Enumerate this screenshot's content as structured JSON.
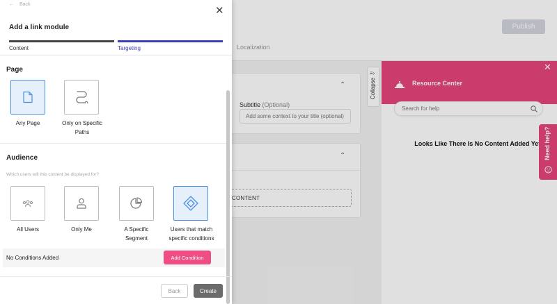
{
  "background": {
    "publish_label": "Publish",
    "localization_tab": "Localization",
    "subtitle_label": "Subtitle",
    "subtitle_optional": "(Optional)",
    "subtitle_placeholder": "Add some context to your title (optional)",
    "content_placeholder": "CONTENT",
    "collapse_label": "Collapse"
  },
  "resource_center": {
    "title": "Resource Center",
    "search_placeholder": "Search for help",
    "empty_message": "Looks Like There Is No Content Added Yet.",
    "need_help": "Need help?",
    "header_color": "#e6457a"
  },
  "modal": {
    "back_link": "Back",
    "title": "Add a link module",
    "tabs": [
      {
        "label": "Content",
        "active": false
      },
      {
        "label": "Targeting",
        "active": true
      }
    ],
    "page_section": {
      "title": "Page",
      "options": [
        {
          "label": "Any Page",
          "icon": "page-icon",
          "selected": true
        },
        {
          "label": "Only on Specific Paths",
          "icon": "path-icon",
          "selected": false
        }
      ]
    },
    "audience_section": {
      "title": "Audience",
      "subtitle": "Which users will this content be displayed for?",
      "options": [
        {
          "label": "All Users",
          "icon": "users-icon",
          "selected": false
        },
        {
          "label": "Only Me",
          "icon": "user-icon",
          "selected": false
        },
        {
          "label": "A Specific Segment",
          "icon": "pie-chart-icon",
          "selected": false
        },
        {
          "label": "Users that match specific conditions",
          "icon": "diamond-icon",
          "selected": true
        }
      ]
    },
    "conditions": {
      "empty_text": "No Conditions Added",
      "add_label": "Add Condition"
    },
    "footer": {
      "back_label": "Back",
      "create_label": "Create"
    },
    "accent_color": "#3b3fb3",
    "selected_color": "#4a90e2"
  }
}
